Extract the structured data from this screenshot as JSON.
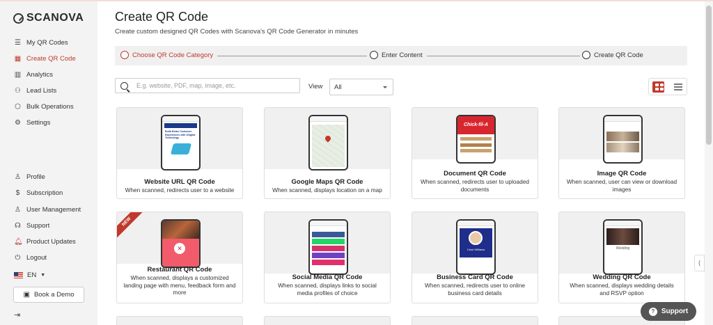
{
  "brand": {
    "name": "SCANOVA"
  },
  "sidebar": {
    "items": [
      {
        "label": "My QR Codes",
        "icon": "list-icon"
      },
      {
        "label": "Create QR Code",
        "icon": "qr-icon",
        "active": true
      },
      {
        "label": "Analytics",
        "icon": "bar-chart-icon"
      },
      {
        "label": "Lead Lists",
        "icon": "users-icon"
      },
      {
        "label": "Bulk Operations",
        "icon": "box-icon"
      },
      {
        "label": "Settings",
        "icon": "gear-icon"
      }
    ],
    "bottom_items": [
      {
        "label": "Profile",
        "icon": "user-icon"
      },
      {
        "label": "Subscription",
        "icon": "dollar-icon"
      },
      {
        "label": "User Management",
        "icon": "user-gear-icon"
      },
      {
        "label": "Support",
        "icon": "headset-icon"
      },
      {
        "label": "Product Updates",
        "icon": "bell-icon"
      },
      {
        "label": "Logout",
        "icon": "power-icon"
      }
    ],
    "language": "EN",
    "demo_label": "Book a Demo"
  },
  "header": {
    "title": "Create QR Code",
    "subtitle": "Create custom designed QR Codes with Scanova's QR Code Generator in minutes"
  },
  "steps": [
    {
      "label": "Choose QR Code Category",
      "active": true
    },
    {
      "label": "Enter Content",
      "active": false
    },
    {
      "label": "Create QR Code",
      "active": false
    }
  ],
  "search": {
    "placeholder": "E.g. website, PDF, map, image, etc.",
    "value": ""
  },
  "view": {
    "label": "View",
    "selected": "All"
  },
  "cards": [
    {
      "title": "Website URL QR Code",
      "desc": "When scanned, redirects user to a website",
      "screen_text": "Build Better Customer Experiences with #Digital Technology"
    },
    {
      "title": "Google Maps QR Code",
      "desc": "When scanned, displays location on a map"
    },
    {
      "title": "Document QR Code",
      "desc": "When scanned, redirects user to uploaded documents",
      "screen_text": "Chick-fil-A"
    },
    {
      "title": "Image QR Code",
      "desc": "When scanned, user can view or download images"
    },
    {
      "title": "Restaurant QR Code",
      "desc": "When scanned, displays a customized landing page with menu, feedback form and more",
      "badge": "NEW"
    },
    {
      "title": "Social Media QR Code",
      "desc": "When scanned, displays links to social media profiles of choice"
    },
    {
      "title": "Business Card QR Code",
      "desc": "When scanned, redirects user to online business card details",
      "screen_text": "Carol Williams"
    },
    {
      "title": "Wedding QR Code",
      "desc": "When scanned, displays wedding details and RSVP option",
      "screen_text": "Wedding"
    }
  ],
  "support_label": "Support",
  "colors": {
    "accent": "#c0392b",
    "sidebar_bg": "#f3f3f3"
  }
}
